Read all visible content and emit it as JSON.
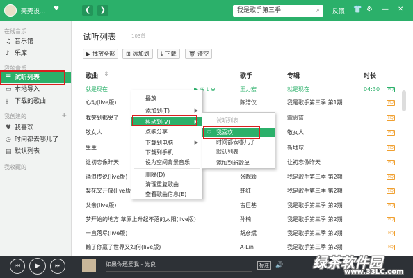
{
  "titlebar": {
    "username": "壳壳设...",
    "heart": "♥",
    "back": "❮",
    "forward": "❯",
    "search_value": "我是歌手第三季",
    "feedback": "反馈",
    "icons": [
      "shirt-icon",
      "gear-icon",
      "minimize-icon",
      "close-icon"
    ]
  },
  "sidebar": {
    "sections": {
      "online": "在线音乐",
      "mine": "我的音乐",
      "created": "我创建的",
      "favorited": "我收藏的"
    },
    "items": [
      {
        "label": "音乐馆",
        "icon": "♫"
      },
      {
        "label": "乐库",
        "icon": "♪"
      },
      {
        "label": "试听列表",
        "icon": "☰"
      },
      {
        "label": "本地导入",
        "icon": "▭"
      },
      {
        "label": "下载的歌曲",
        "icon": "⤓"
      },
      {
        "label": "我喜欢",
        "icon": "♥"
      },
      {
        "label": "时间都去哪儿了",
        "icon": "◷"
      },
      {
        "label": "默认列表",
        "icon": "▤"
      }
    ],
    "add_icon": "+"
  },
  "main": {
    "title": "试听列表",
    "count": "103首",
    "toolbar": {
      "play_all": "播放全部",
      "add_to": "添加到",
      "download": "下载",
      "clear": "清空"
    },
    "columns": {
      "title": "歌曲",
      "artist": "歌手",
      "album": "专辑",
      "duration": "时长"
    },
    "rows": [
      {
        "title": "就是现在",
        "artist": "王力宏",
        "album": "就是现在",
        "duration": "04:30",
        "badge": "HQ"
      },
      {
        "title": "心动(live版)",
        "artist": "陈洁仪",
        "album": "我是歌手第三季 第1期",
        "duration": "",
        "badge": "HQ"
      },
      {
        "title": "我笑到都哭了",
        "artist": "",
        "album": "霏恶篮",
        "duration": "",
        "badge": "HQ"
      },
      {
        "title": "敬女人",
        "artist": "",
        "album": "敬女人",
        "duration": "",
        "badge": "HQ"
      },
      {
        "title": "生生",
        "artist": "",
        "album": "新地球",
        "duration": "",
        "badge": "HQ"
      },
      {
        "title": "让初恋像昨天",
        "artist": "",
        "album": "让初恋像昨天",
        "duration": "",
        "badge": "HQ"
      },
      {
        "title": "涌浪传说(live版)",
        "artist": "张靓颖",
        "album": "我是歌手第三季 第2期",
        "duration": "",
        "badge": "HQ"
      },
      {
        "title": "梨花又开放(live版)",
        "artist": "韩红",
        "album": "我是歌手第三季 第2期",
        "duration": "",
        "badge": "HQ"
      },
      {
        "title": "父亲(live版)",
        "artist": "古巨基",
        "album": "我是歌手第三季 第2期",
        "duration": "",
        "badge": "HQ"
      },
      {
        "title": "梦开始的地方 草原上升起不落的太阳(live版)",
        "artist": "孙楠",
        "album": "我是歌手第三季 第2期",
        "duration": "",
        "badge": "HQ"
      },
      {
        "title": "一直落尽(live版)",
        "artist": "胡彦斌",
        "album": "我是歌手第三季 第2期",
        "duration": "",
        "badge": "HQ"
      },
      {
        "title": "輸了你赢了世界又如何(live版)",
        "artist": "A-Lin",
        "album": "我是歌手第三季 第2期",
        "duration": "",
        "badge": "HQ"
      }
    ]
  },
  "context_menu": {
    "items": [
      "播放",
      "添加到(T)",
      "移动到(V)",
      "点歌分享",
      "下载到电脑",
      "下载到手机",
      "设为空间背景音乐",
      "删除(D)",
      "清理重复歌曲",
      "查看歌曲信息(E)"
    ]
  },
  "submenu": {
    "items": [
      "试听列表",
      "我喜欢",
      "时间都去哪儿了",
      "默认列表",
      "添加到新歌单"
    ]
  },
  "player": {
    "now_playing": "如果你还爱我 - 光良",
    "quality": "标准",
    "prev": "⏮",
    "play": "▶",
    "next": "⏭"
  },
  "watermark": {
    "logo": "绿茶软件园",
    "url": "www.33LC.com"
  },
  "colors": {
    "accent": "#2bb06a",
    "highlight_box": "#d81f1f",
    "player_bg": "#2d3136"
  }
}
